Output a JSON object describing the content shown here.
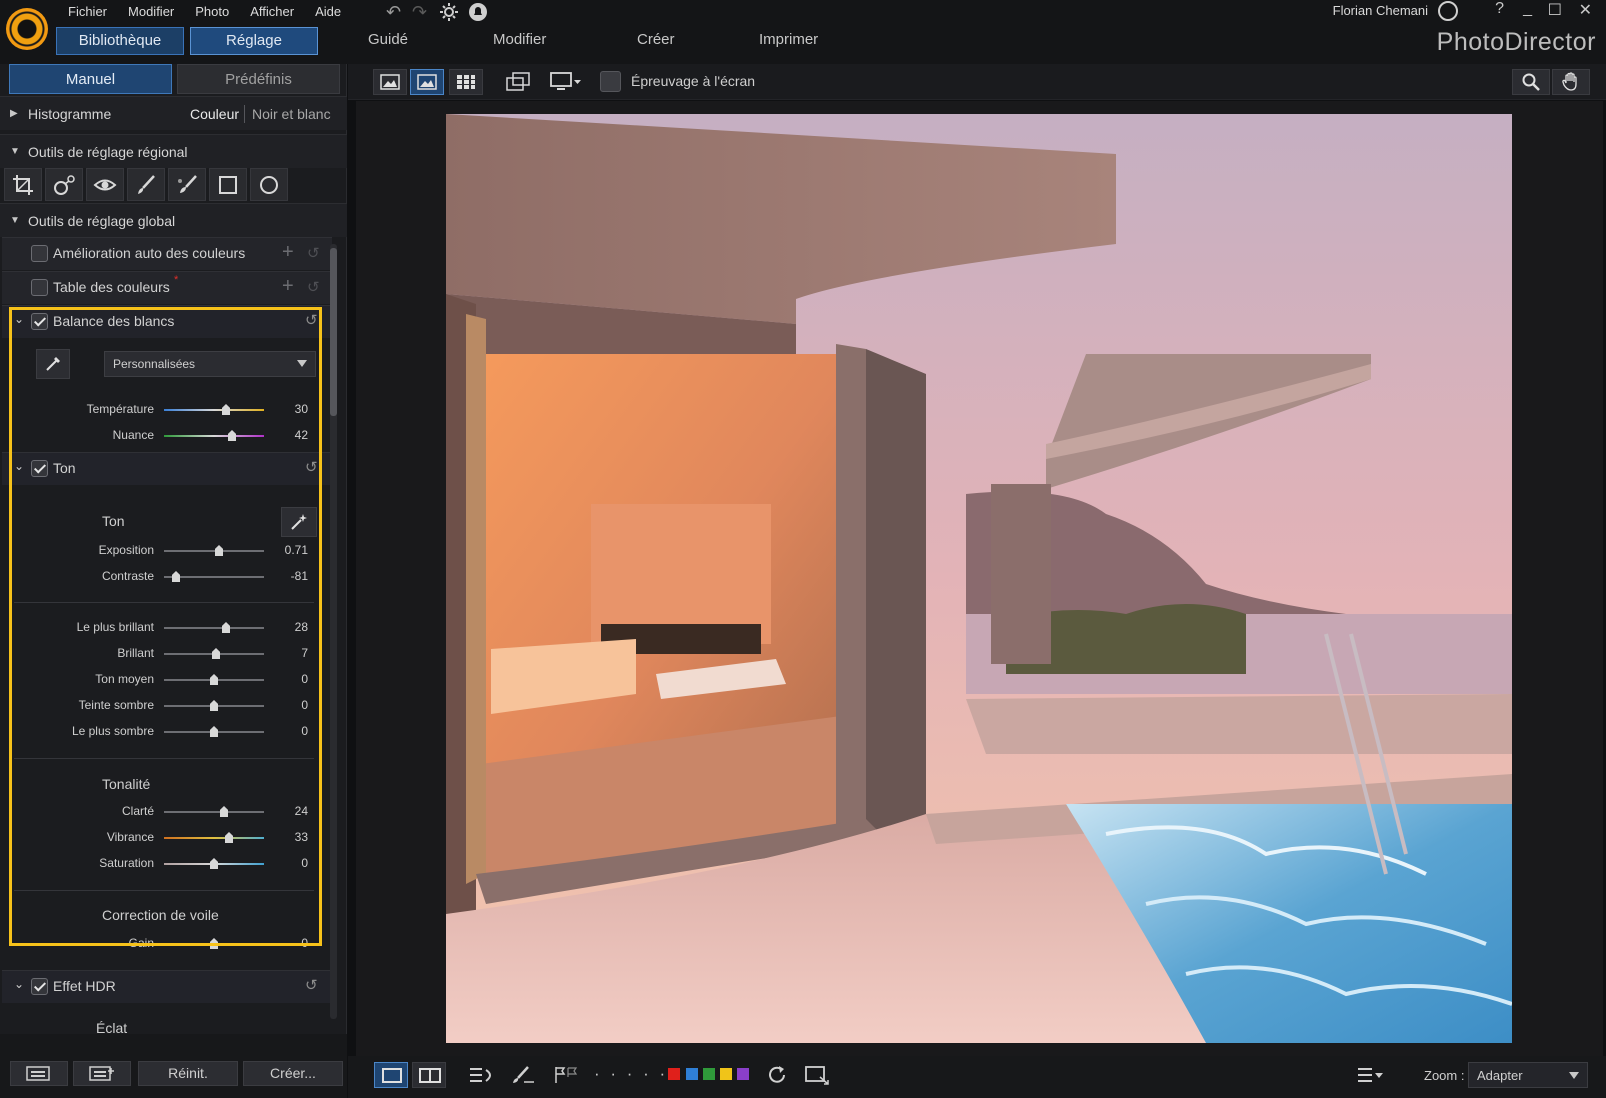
{
  "app": {
    "title": "PhotoDirector",
    "user": "Florian Chemani"
  },
  "menu": [
    "Fichier",
    "Modifier",
    "Photo",
    "Afficher",
    "Aide"
  ],
  "window_controls": {
    "help": "?",
    "minimize": "_",
    "maximize": "☐",
    "close": "✕"
  },
  "modes": {
    "library": "Bibliothèque",
    "adjust": "Réglage"
  },
  "sections": [
    "Guidé",
    "Modifier",
    "Créer",
    "Imprimer"
  ],
  "panel_tabs": {
    "manual": "Manuel",
    "presets": "Prédéfinis"
  },
  "histogram": {
    "label": "Histogramme",
    "color": "Couleur",
    "bw": "Noir et blanc"
  },
  "regional": {
    "label": "Outils de réglage régional"
  },
  "global": {
    "label": "Outils de réglage global"
  },
  "tools": {
    "auto_color": {
      "label": "Amélioration auto des couleurs",
      "checked": false
    },
    "color_table": {
      "label": "Table des couleurs",
      "checked": false,
      "marker": "*"
    }
  },
  "white_balance": {
    "label": "Balance des blancs",
    "checked": true,
    "mode": "Personnalisées",
    "sliders": [
      {
        "label": "Température",
        "value": "30",
        "pos": 0.62
      },
      {
        "label": "Nuance",
        "value": "42",
        "pos": 0.68
      }
    ]
  },
  "tone": {
    "label": "Ton",
    "checked": true,
    "sub_ton": "Ton",
    "sliders_a": [
      {
        "label": "Exposition",
        "value": "0.71",
        "pos": 0.55
      },
      {
        "label": "Contraste",
        "value": "-81",
        "pos": 0.12
      }
    ],
    "sliders_b": [
      {
        "label": "Le plus brillant",
        "value": "28",
        "pos": 0.62
      },
      {
        "label": "Brillant",
        "value": "7",
        "pos": 0.52
      },
      {
        "label": "Ton moyen",
        "value": "0",
        "pos": 0.5
      },
      {
        "label": "Teinte sombre",
        "value": "0",
        "pos": 0.5
      },
      {
        "label": "Le plus sombre",
        "value": "0",
        "pos": 0.5
      }
    ],
    "sub_tonality": "Tonalité",
    "sliders_c": [
      {
        "label": "Clarté",
        "value": "24",
        "pos": 0.6
      },
      {
        "label": "Vibrance",
        "value": "33",
        "pos": 0.65
      },
      {
        "label": "Saturation",
        "value": "0",
        "pos": 0.5
      }
    ],
    "sub_haze": "Correction de voile",
    "sliders_d": [
      {
        "label": "Gain",
        "value": "0",
        "pos": 0.5
      }
    ]
  },
  "hdr": {
    "label": "Effet HDR",
    "checked": true,
    "sub": "Éclat"
  },
  "bottom_left": {
    "reset": "Réinit.",
    "create": "Créer..."
  },
  "toolbar": {
    "softproof": "Épreuvage à l'écran"
  },
  "bottom": {
    "zoom_label": "Zoom :",
    "zoom_value": "Adapter",
    "flags": "· · · · ·"
  },
  "colors": {
    "accent": "#1f4572",
    "highlight": "#f7c21a",
    "labels": [
      "#e0201b",
      "#2f7fd6",
      "#2f9a3a",
      "#f0c419",
      "#8a3fc9"
    ]
  }
}
